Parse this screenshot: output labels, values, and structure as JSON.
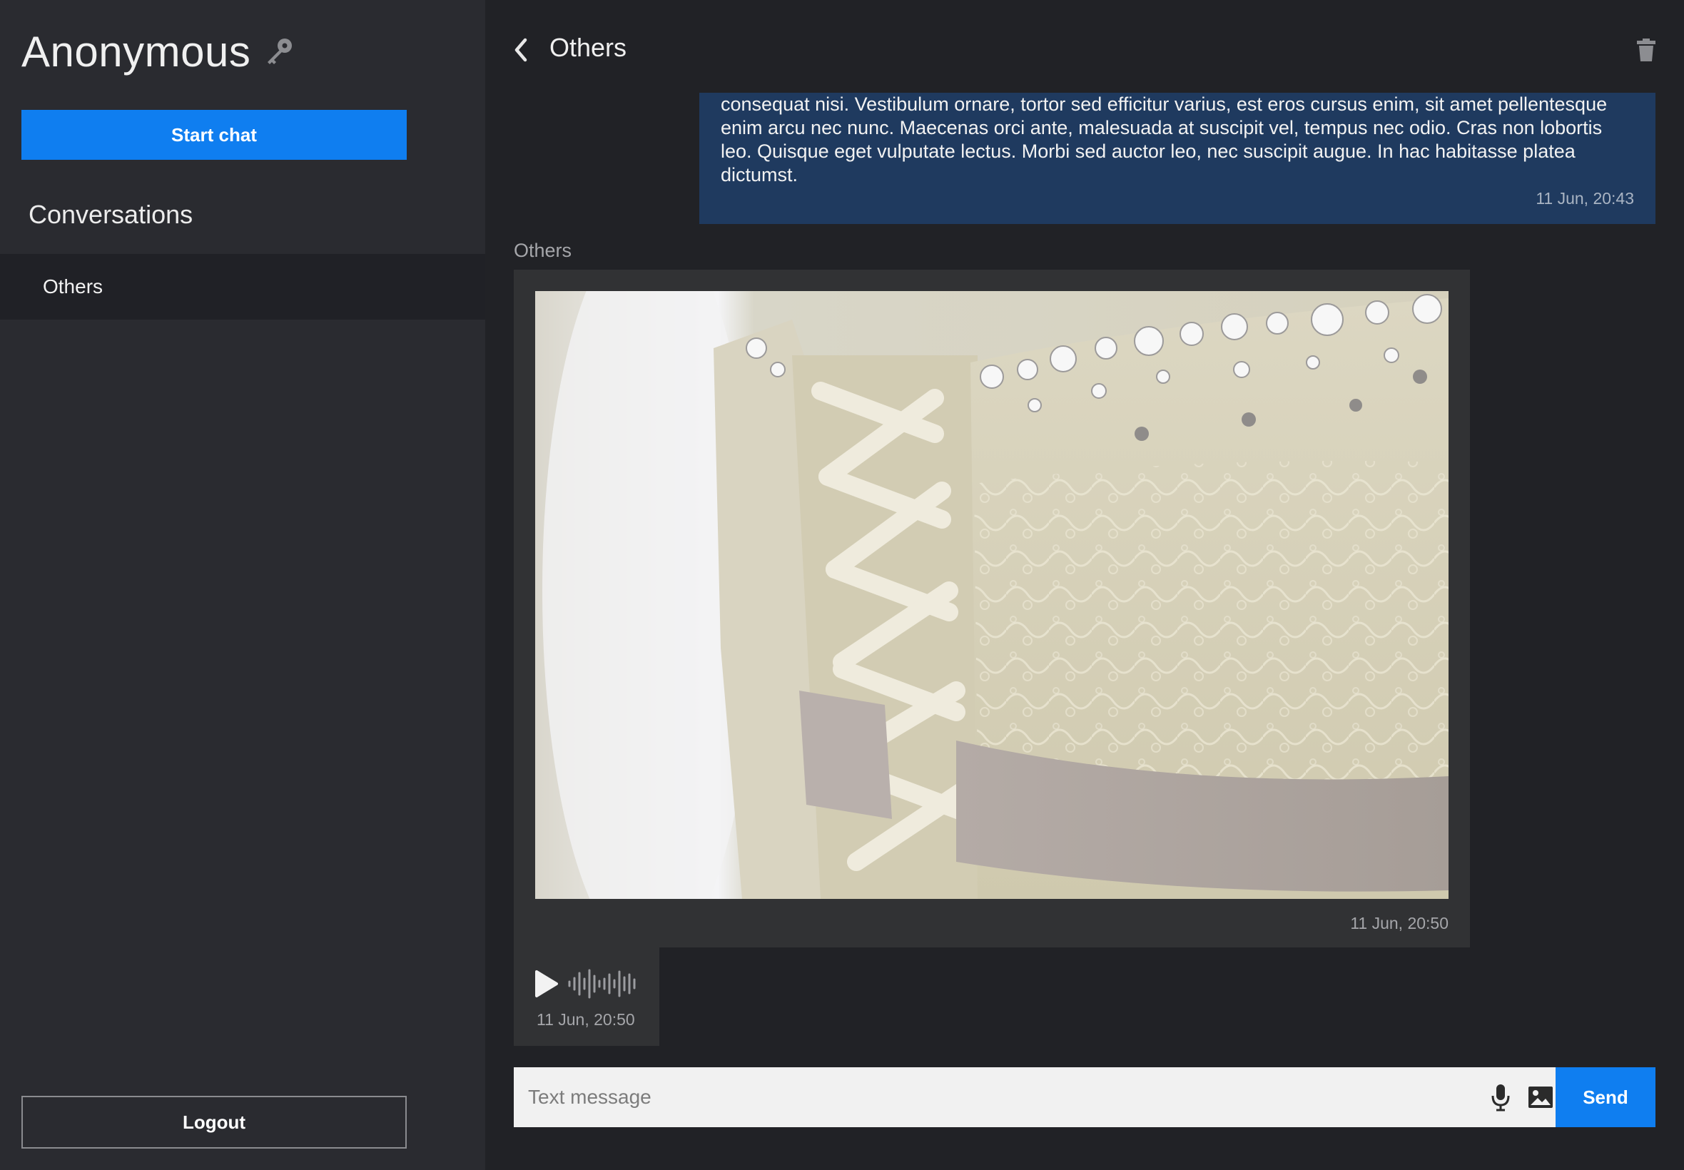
{
  "sidebar": {
    "username": "Anonymous",
    "start_chat_label": "Start chat",
    "conversations_heading": "Conversations",
    "conversations": [
      {
        "label": "Others"
      }
    ],
    "logout_label": "Logout"
  },
  "chat": {
    "title": "Others",
    "messages": [
      {
        "type": "text",
        "own": true,
        "text": "consequat nisi. Vestibulum ornare, tortor sed efficitur varius, est eros cursus enim, sit amet pellentesque enim arcu nec nunc. Maecenas orci ante, malesuada at suscipit vel, tempus nec odio. Cras non lobortis leo. Quisque eget vulputate lectus. Morbi sed auctor leo, nec suscipit augue. In hac habitasse platea dictumst.",
        "time": "11 Jun, 20:43"
      },
      {
        "type": "image",
        "sender": "Others",
        "time": "11 Jun, 20:50"
      },
      {
        "type": "audio",
        "time": "11 Jun, 20:50"
      }
    ]
  },
  "composer": {
    "placeholder": "Text message",
    "send_label": "Send"
  },
  "icons": {
    "key": "key-icon",
    "back": "chevron-left-icon",
    "trash": "trash-icon",
    "play": "play-icon",
    "waveform": "waveform-icon",
    "mic": "microphone-icon",
    "image": "image-icon"
  },
  "colors": {
    "accent": "#0f7ef0",
    "own_bubble": "#1f3a5f",
    "sidebar_bg": "#2a2b30",
    "main_bg": "#212226"
  }
}
